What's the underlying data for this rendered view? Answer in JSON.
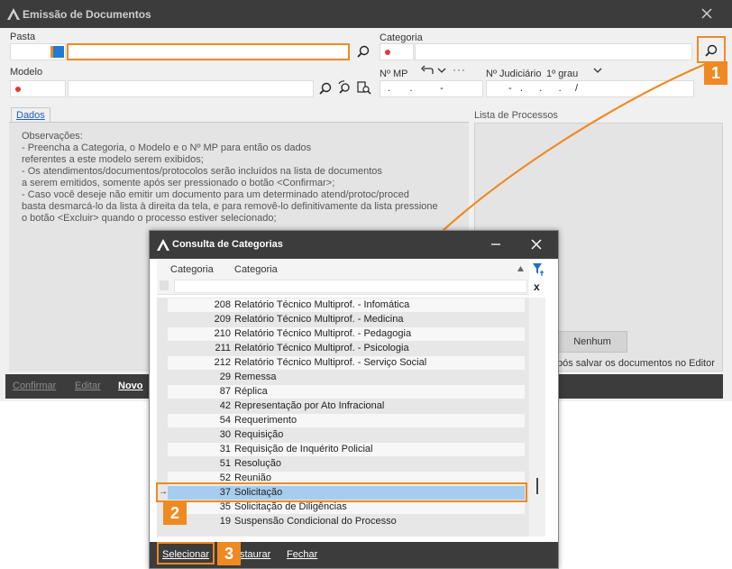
{
  "main": {
    "title": "Emissão de Documentos",
    "labels": {
      "pasta": "Pasta",
      "categoria": "Categoria",
      "modelo": "Modelo",
      "nro_mp": "Nº MP",
      "nro_judiciario": "Nº Judiciário",
      "grau": "1º grau"
    },
    "fields": {
      "nro_mp_mask": ".       .          -",
      "nro_judiciario_mask": "-   .      .      .     /"
    },
    "tab_label": "Dados",
    "observacoes": [
      "Observações:",
      "  - Preencha a Categoria, o Modelo e o Nº MP para então os dados",
      "referentes a este modelo serem exibidos;",
      "  - Os atendimentos/documentos/protocolos serão incluídos na lista de documentos",
      "a serem emitidos, somente após ser pressionado o botão <Confirmar>;",
      "  - Caso você deseje não emitir um documento para um determinado atend/protoc/proced",
      "basta desmarcá-lo da lista à direita da tela, e para removê-lo definitivamente da lista pressione",
      "o botão <Excluir> quando o processo estiver selecionado;"
    ],
    "lista_processos_label": "Lista de Processos",
    "nenhum_label": "Nenhum",
    "editor_text": "pós salvar os documentos no Editor",
    "buttons": {
      "confirmar": "Confirmar",
      "editar": "Editar",
      "novo": "Novo"
    }
  },
  "dialog": {
    "title": "Consulta de Categorias",
    "col_code": "Categoria",
    "col_name": "Categoria",
    "rows": [
      {
        "code": "208",
        "name": "Relatório Técnico Multiprof. - Infomática"
      },
      {
        "code": "209",
        "name": "Relatório Técnico Multiprof. - Medicina"
      },
      {
        "code": "210",
        "name": "Relatório Técnico Multiprof. - Pedagogia"
      },
      {
        "code": "211",
        "name": "Relatório Técnico Multiprof. - Psicologia"
      },
      {
        "code": "212",
        "name": "Relatório Técnico Multiprof. - Serviço Social"
      },
      {
        "code": "29",
        "name": "Remessa"
      },
      {
        "code": "87",
        "name": "Réplica"
      },
      {
        "code": "42",
        "name": "Representação por Ato Infracional"
      },
      {
        "code": "54",
        "name": "Requerimento"
      },
      {
        "code": "30",
        "name": "Requisição"
      },
      {
        "code": "31",
        "name": "Requisição de Inquérito Policial"
      },
      {
        "code": "51",
        "name": "Resolução"
      },
      {
        "code": "52",
        "name": "Reunião"
      },
      {
        "code": "37",
        "name": "Solicitação"
      },
      {
        "code": "35",
        "name": "Solicitação de Diligências"
      },
      {
        "code": "19",
        "name": "Suspensão Condicional do Processo"
      }
    ],
    "selected_index": 13,
    "buttons": {
      "selecionar": "Selecionar",
      "restaurar": "staurar",
      "fechar": "Fechar"
    },
    "clear_filter": "x"
  },
  "callouts": [
    "1",
    "2",
    "3"
  ],
  "colors": {
    "accent": "#ef8a22",
    "titlebar": "#3c3c3c",
    "selection": "#a6ccee",
    "required_dot": "#e53935"
  }
}
